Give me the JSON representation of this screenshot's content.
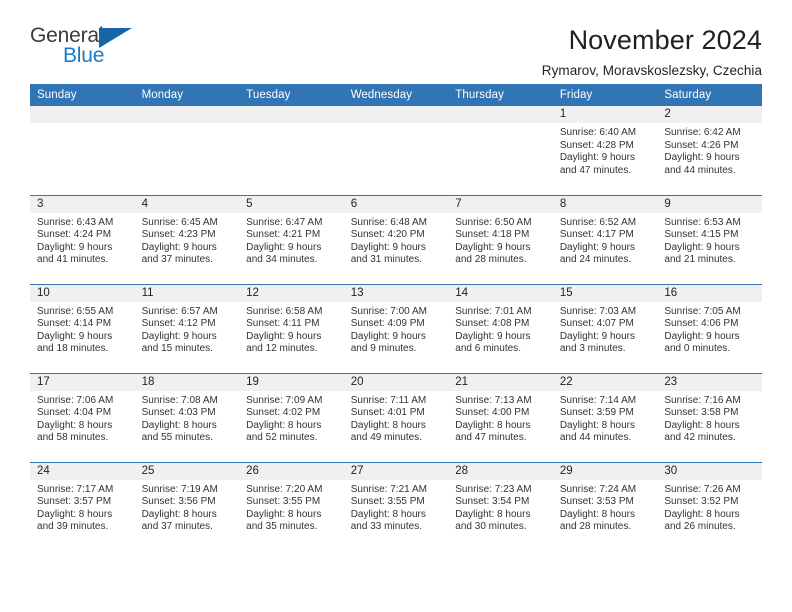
{
  "brand": {
    "name_part1": "General",
    "name_part2": "Blue",
    "triangle_color": "#1565a8",
    "blue_text_color": "#1f7ac4"
  },
  "header": {
    "title": "November 2024",
    "subtitle": "Rymarov, Moravskoslezsky, Czechia",
    "accent_color": "#3275b5",
    "band_color": "#f0f0f0"
  },
  "weekday_headers": [
    "Sunday",
    "Monday",
    "Tuesday",
    "Wednesday",
    "Thursday",
    "Friday",
    "Saturday"
  ],
  "labels": {
    "sunrise_prefix": "Sunrise:",
    "sunset_prefix": "Sunset:",
    "daylight_prefix": "Daylight:"
  },
  "weeks": [
    [
      {
        "day": "",
        "line1": "",
        "line2": "",
        "line3": "",
        "line4": "",
        "empty": true
      },
      {
        "day": "",
        "line1": "",
        "line2": "",
        "line3": "",
        "line4": "",
        "empty": true
      },
      {
        "day": "",
        "line1": "",
        "line2": "",
        "line3": "",
        "line4": "",
        "empty": true
      },
      {
        "day": "",
        "line1": "",
        "line2": "",
        "line3": "",
        "line4": "",
        "empty": true
      },
      {
        "day": "",
        "line1": "",
        "line2": "",
        "line3": "",
        "line4": "",
        "empty": true
      },
      {
        "day": "1",
        "line1": "Sunrise: 6:40 AM",
        "line2": "Sunset: 4:28 PM",
        "line3": "Daylight: 9 hours",
        "line4": "and 47 minutes.",
        "empty": false
      },
      {
        "day": "2",
        "line1": "Sunrise: 6:42 AM",
        "line2": "Sunset: 4:26 PM",
        "line3": "Daylight: 9 hours",
        "line4": "and 44 minutes.",
        "empty": false
      }
    ],
    [
      {
        "day": "3",
        "line1": "Sunrise: 6:43 AM",
        "line2": "Sunset: 4:24 PM",
        "line3": "Daylight: 9 hours",
        "line4": "and 41 minutes.",
        "empty": false
      },
      {
        "day": "4",
        "line1": "Sunrise: 6:45 AM",
        "line2": "Sunset: 4:23 PM",
        "line3": "Daylight: 9 hours",
        "line4": "and 37 minutes.",
        "empty": false
      },
      {
        "day": "5",
        "line1": "Sunrise: 6:47 AM",
        "line2": "Sunset: 4:21 PM",
        "line3": "Daylight: 9 hours",
        "line4": "and 34 minutes.",
        "empty": false
      },
      {
        "day": "6",
        "line1": "Sunrise: 6:48 AM",
        "line2": "Sunset: 4:20 PM",
        "line3": "Daylight: 9 hours",
        "line4": "and 31 minutes.",
        "empty": false
      },
      {
        "day": "7",
        "line1": "Sunrise: 6:50 AM",
        "line2": "Sunset: 4:18 PM",
        "line3": "Daylight: 9 hours",
        "line4": "and 28 minutes.",
        "empty": false
      },
      {
        "day": "8",
        "line1": "Sunrise: 6:52 AM",
        "line2": "Sunset: 4:17 PM",
        "line3": "Daylight: 9 hours",
        "line4": "and 24 minutes.",
        "empty": false
      },
      {
        "day": "9",
        "line1": "Sunrise: 6:53 AM",
        "line2": "Sunset: 4:15 PM",
        "line3": "Daylight: 9 hours",
        "line4": "and 21 minutes.",
        "empty": false
      }
    ],
    [
      {
        "day": "10",
        "line1": "Sunrise: 6:55 AM",
        "line2": "Sunset: 4:14 PM",
        "line3": "Daylight: 9 hours",
        "line4": "and 18 minutes.",
        "empty": false
      },
      {
        "day": "11",
        "line1": "Sunrise: 6:57 AM",
        "line2": "Sunset: 4:12 PM",
        "line3": "Daylight: 9 hours",
        "line4": "and 15 minutes.",
        "empty": false
      },
      {
        "day": "12",
        "line1": "Sunrise: 6:58 AM",
        "line2": "Sunset: 4:11 PM",
        "line3": "Daylight: 9 hours",
        "line4": "and 12 minutes.",
        "empty": false
      },
      {
        "day": "13",
        "line1": "Sunrise: 7:00 AM",
        "line2": "Sunset: 4:09 PM",
        "line3": "Daylight: 9 hours",
        "line4": "and 9 minutes.",
        "empty": false
      },
      {
        "day": "14",
        "line1": "Sunrise: 7:01 AM",
        "line2": "Sunset: 4:08 PM",
        "line3": "Daylight: 9 hours",
        "line4": "and 6 minutes.",
        "empty": false
      },
      {
        "day": "15",
        "line1": "Sunrise: 7:03 AM",
        "line2": "Sunset: 4:07 PM",
        "line3": "Daylight: 9 hours",
        "line4": "and 3 minutes.",
        "empty": false
      },
      {
        "day": "16",
        "line1": "Sunrise: 7:05 AM",
        "line2": "Sunset: 4:06 PM",
        "line3": "Daylight: 9 hours",
        "line4": "and 0 minutes.",
        "empty": false
      }
    ],
    [
      {
        "day": "17",
        "line1": "Sunrise: 7:06 AM",
        "line2": "Sunset: 4:04 PM",
        "line3": "Daylight: 8 hours",
        "line4": "and 58 minutes.",
        "empty": false
      },
      {
        "day": "18",
        "line1": "Sunrise: 7:08 AM",
        "line2": "Sunset: 4:03 PM",
        "line3": "Daylight: 8 hours",
        "line4": "and 55 minutes.",
        "empty": false
      },
      {
        "day": "19",
        "line1": "Sunrise: 7:09 AM",
        "line2": "Sunset: 4:02 PM",
        "line3": "Daylight: 8 hours",
        "line4": "and 52 minutes.",
        "empty": false
      },
      {
        "day": "20",
        "line1": "Sunrise: 7:11 AM",
        "line2": "Sunset: 4:01 PM",
        "line3": "Daylight: 8 hours",
        "line4": "and 49 minutes.",
        "empty": false
      },
      {
        "day": "21",
        "line1": "Sunrise: 7:13 AM",
        "line2": "Sunset: 4:00 PM",
        "line3": "Daylight: 8 hours",
        "line4": "and 47 minutes.",
        "empty": false
      },
      {
        "day": "22",
        "line1": "Sunrise: 7:14 AM",
        "line2": "Sunset: 3:59 PM",
        "line3": "Daylight: 8 hours",
        "line4": "and 44 minutes.",
        "empty": false
      },
      {
        "day": "23",
        "line1": "Sunrise: 7:16 AM",
        "line2": "Sunset: 3:58 PM",
        "line3": "Daylight: 8 hours",
        "line4": "and 42 minutes.",
        "empty": false
      }
    ],
    [
      {
        "day": "24",
        "line1": "Sunrise: 7:17 AM",
        "line2": "Sunset: 3:57 PM",
        "line3": "Daylight: 8 hours",
        "line4": "and 39 minutes.",
        "empty": false
      },
      {
        "day": "25",
        "line1": "Sunrise: 7:19 AM",
        "line2": "Sunset: 3:56 PM",
        "line3": "Daylight: 8 hours",
        "line4": "and 37 minutes.",
        "empty": false
      },
      {
        "day": "26",
        "line1": "Sunrise: 7:20 AM",
        "line2": "Sunset: 3:55 PM",
        "line3": "Daylight: 8 hours",
        "line4": "and 35 minutes.",
        "empty": false
      },
      {
        "day": "27",
        "line1": "Sunrise: 7:21 AM",
        "line2": "Sunset: 3:55 PM",
        "line3": "Daylight: 8 hours",
        "line4": "and 33 minutes.",
        "empty": false
      },
      {
        "day": "28",
        "line1": "Sunrise: 7:23 AM",
        "line2": "Sunset: 3:54 PM",
        "line3": "Daylight: 8 hours",
        "line4": "and 30 minutes.",
        "empty": false
      },
      {
        "day": "29",
        "line1": "Sunrise: 7:24 AM",
        "line2": "Sunset: 3:53 PM",
        "line3": "Daylight: 8 hours",
        "line4": "and 28 minutes.",
        "empty": false
      },
      {
        "day": "30",
        "line1": "Sunrise: 7:26 AM",
        "line2": "Sunset: 3:52 PM",
        "line3": "Daylight: 8 hours",
        "line4": "and 26 minutes.",
        "empty": false
      }
    ]
  ]
}
